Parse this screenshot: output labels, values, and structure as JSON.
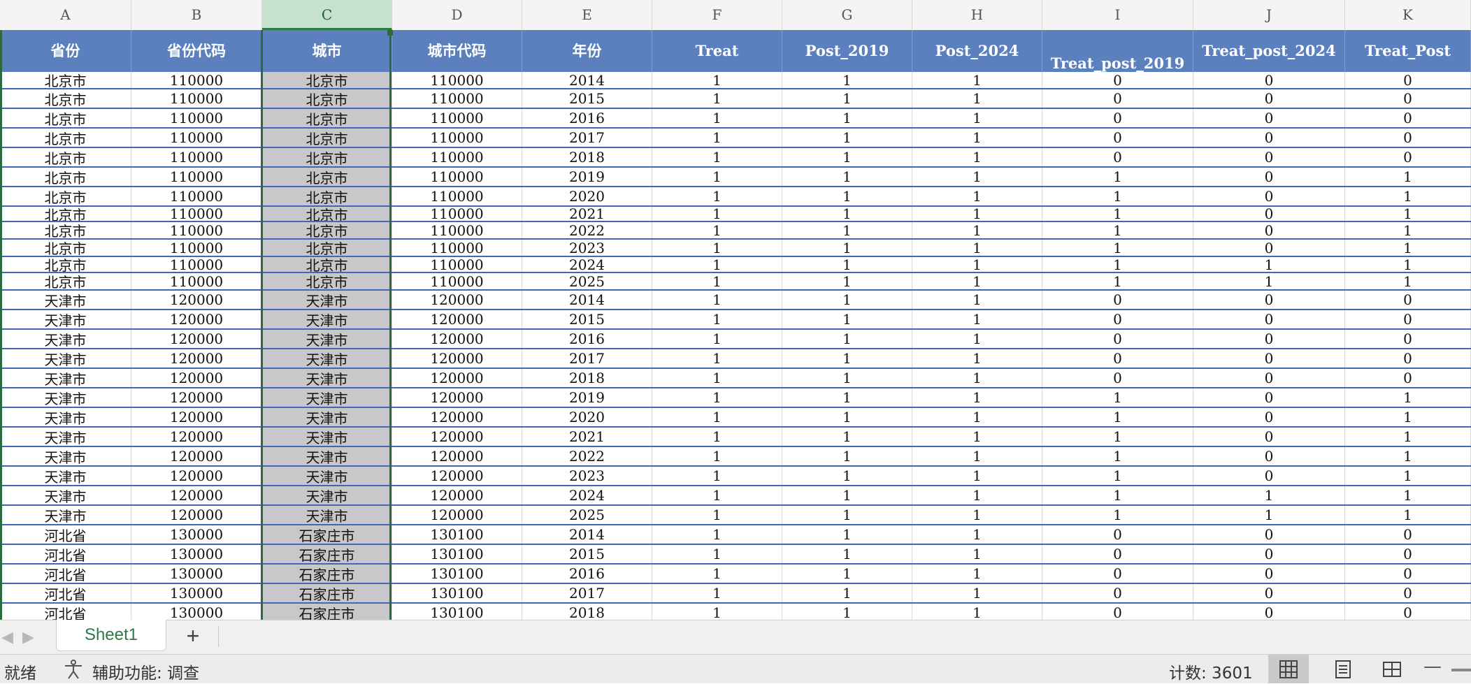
{
  "columns": [
    "A",
    "B",
    "C",
    "D",
    "E",
    "F",
    "G",
    "H",
    "I",
    "J",
    "K"
  ],
  "headers": [
    "省份",
    "省份代码",
    "城市",
    "城市代码",
    "年份",
    "Treat",
    "Post_2019",
    "Post_2024",
    "Treat_post_2019",
    "Treat_post_2024",
    "Treat_Post"
  ],
  "rows": [
    [
      "北京市",
      "110000",
      "北京市",
      "110000",
      "2014",
      "1",
      "1",
      "1",
      "0",
      "0",
      "0"
    ],
    [
      "北京市",
      "110000",
      "北京市",
      "110000",
      "2015",
      "1",
      "1",
      "1",
      "0",
      "0",
      "0"
    ],
    [
      "北京市",
      "110000",
      "北京市",
      "110000",
      "2016",
      "1",
      "1",
      "1",
      "0",
      "0",
      "0"
    ],
    [
      "北京市",
      "110000",
      "北京市",
      "110000",
      "2017",
      "1",
      "1",
      "1",
      "0",
      "0",
      "0"
    ],
    [
      "北京市",
      "110000",
      "北京市",
      "110000",
      "2018",
      "1",
      "1",
      "1",
      "0",
      "0",
      "0"
    ],
    [
      "北京市",
      "110000",
      "北京市",
      "110000",
      "2019",
      "1",
      "1",
      "1",
      "1",
      "0",
      "1"
    ],
    [
      "北京市",
      "110000",
      "北京市",
      "110000",
      "2020",
      "1",
      "1",
      "1",
      "1",
      "0",
      "1"
    ],
    [
      "北京市",
      "110000",
      "北京市",
      "110000",
      "2021",
      "1",
      "1",
      "1",
      "1",
      "0",
      "1"
    ],
    [
      "北京市",
      "110000",
      "北京市",
      "110000",
      "2022",
      "1",
      "1",
      "1",
      "1",
      "0",
      "1"
    ],
    [
      "北京市",
      "110000",
      "北京市",
      "110000",
      "2023",
      "1",
      "1",
      "1",
      "1",
      "0",
      "1"
    ],
    [
      "北京市",
      "110000",
      "北京市",
      "110000",
      "2024",
      "1",
      "1",
      "1",
      "1",
      "1",
      "1"
    ],
    [
      "北京市",
      "110000",
      "北京市",
      "110000",
      "2025",
      "1",
      "1",
      "1",
      "1",
      "1",
      "1"
    ],
    [
      "天津市",
      "120000",
      "天津市",
      "120000",
      "2014",
      "1",
      "1",
      "1",
      "0",
      "0",
      "0"
    ],
    [
      "天津市",
      "120000",
      "天津市",
      "120000",
      "2015",
      "1",
      "1",
      "1",
      "0",
      "0",
      "0"
    ],
    [
      "天津市",
      "120000",
      "天津市",
      "120000",
      "2016",
      "1",
      "1",
      "1",
      "0",
      "0",
      "0"
    ],
    [
      "天津市",
      "120000",
      "天津市",
      "120000",
      "2017",
      "1",
      "1",
      "1",
      "0",
      "0",
      "0"
    ],
    [
      "天津市",
      "120000",
      "天津市",
      "120000",
      "2018",
      "1",
      "1",
      "1",
      "0",
      "0",
      "0"
    ],
    [
      "天津市",
      "120000",
      "天津市",
      "120000",
      "2019",
      "1",
      "1",
      "1",
      "1",
      "0",
      "1"
    ],
    [
      "天津市",
      "120000",
      "天津市",
      "120000",
      "2020",
      "1",
      "1",
      "1",
      "1",
      "0",
      "1"
    ],
    [
      "天津市",
      "120000",
      "天津市",
      "120000",
      "2021",
      "1",
      "1",
      "1",
      "1",
      "0",
      "1"
    ],
    [
      "天津市",
      "120000",
      "天津市",
      "120000",
      "2022",
      "1",
      "1",
      "1",
      "1",
      "0",
      "1"
    ],
    [
      "天津市",
      "120000",
      "天津市",
      "120000",
      "2023",
      "1",
      "1",
      "1",
      "1",
      "0",
      "1"
    ],
    [
      "天津市",
      "120000",
      "天津市",
      "120000",
      "2024",
      "1",
      "1",
      "1",
      "1",
      "1",
      "1"
    ],
    [
      "天津市",
      "120000",
      "天津市",
      "120000",
      "2025",
      "1",
      "1",
      "1",
      "1",
      "1",
      "1"
    ],
    [
      "河北省",
      "130000",
      "石家庄市",
      "130100",
      "2014",
      "1",
      "1",
      "1",
      "0",
      "0",
      "0"
    ],
    [
      "河北省",
      "130000",
      "石家庄市",
      "130100",
      "2015",
      "1",
      "1",
      "1",
      "0",
      "0",
      "0"
    ],
    [
      "河北省",
      "130000",
      "石家庄市",
      "130100",
      "2016",
      "1",
      "1",
      "1",
      "0",
      "0",
      "0"
    ],
    [
      "河北省",
      "130000",
      "石家庄市",
      "130100",
      "2017",
      "1",
      "1",
      "1",
      "0",
      "0",
      "0"
    ],
    [
      "河北省",
      "130000",
      "石家庄市",
      "130100",
      "2018",
      "1",
      "1",
      "1",
      "0",
      "0",
      "0"
    ]
  ],
  "selected_column": "C",
  "sheet_tab": "Sheet1",
  "add_sheet_label": "+",
  "status": {
    "ready": "就绪",
    "accessibility": "辅助功能: 调查",
    "count": "计数: 3601"
  },
  "colors": {
    "header_bg": "#5b80bd",
    "row_border": "#3f68b6",
    "selected_col_bg": "#c8c8cb",
    "selection_border": "#2d6b3f",
    "tab_text": "#2d7a46"
  }
}
